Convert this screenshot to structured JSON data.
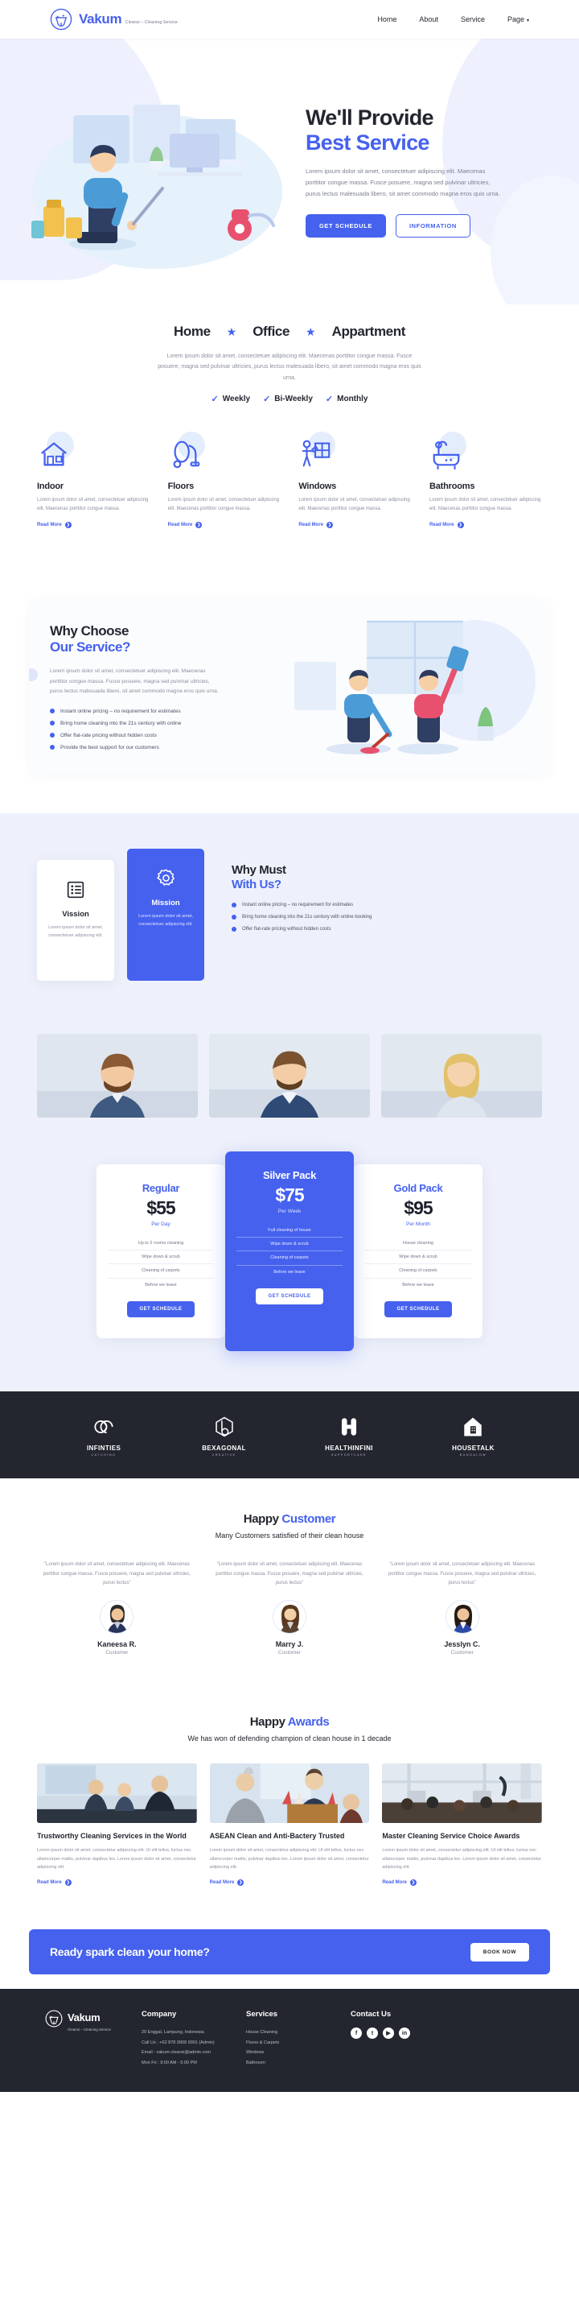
{
  "brand": {
    "name": "Vakum",
    "tagline": "Cleansi – Cleaning Service"
  },
  "nav": {
    "items": [
      "Home",
      "About",
      "Service",
      "Page"
    ],
    "caret": "▾"
  },
  "hero": {
    "title_line1": "We'll Provide",
    "title_line2": "Best Service",
    "desc": "Lorem ipsum dolor sit amet, consectetuer adipiscing elit. Maecenas porttitor congue massa. Fusce posuere, magna sed pulvinar ultricies, purus lectus malesuada libero, sit amet commodo magna eros quis urna.",
    "btn_primary": "GET SCHEDULE",
    "btn_outline": "INFORMATION"
  },
  "service_tabs": {
    "tabs": [
      "Home",
      "Office",
      "Appartment"
    ],
    "star": "★",
    "desc": "Lorem ipsum dolor sit amet, consectetuer adipiscing elit. Maecenas porttitor congue massa. Fusce posuere, magna sed pulvinar ultricies, purus lectus malesuada libero, sit amet commodo magna eros quis urna.",
    "frequencies": [
      "Weekly",
      "Bi-Weekly",
      "Monthly"
    ],
    "check": "✓"
  },
  "service_cards": {
    "read_more": "Read More",
    "arrow": "❯",
    "items": [
      {
        "icon": "house-icon",
        "title": "Indoor",
        "desc": "Lorem ipsum dolor sit amet, consectetuer adipiscing elit. Maecenas porttitor congue massa."
      },
      {
        "icon": "vacuum-icon",
        "title": "Floors",
        "desc": "Lorem ipsum dolor sit amet, consectetuer adipiscing elit. Maecenas porttitor congue massa."
      },
      {
        "icon": "window-cleaner-icon",
        "title": "Windows",
        "desc": "Lorem ipsum dolor sit amet, consectetuer adipiscing elit. Maecenas porttitor congue massa."
      },
      {
        "icon": "bathtub-icon",
        "title": "Bathrooms",
        "desc": "Lorem ipsum dolor sit amet, consectetuer adipiscing elit. Maecenas porttitor congue massa."
      }
    ]
  },
  "why_choose": {
    "title_line1": "Why Choose",
    "title_line2": "Our Service?",
    "desc": "Lorem ipsum dolor sit amet, consectetuer adipiscing elit. Maecenas porttitor congue massa. Fusce posuere, magna sed pulvinar ultricies, purus lectus malesuada libero, sit amet commodo magna eros quis urna.",
    "points": [
      "Instant online pricing – no requirement for estimates",
      "Bring home cleaning into the 21s century with online",
      "Offer flat-rate pricing without hidden costs",
      "Provide the best support for our customers"
    ]
  },
  "vision_mission": {
    "cards": [
      {
        "icon": "list-icon",
        "title": "Vission",
        "desc": "Lorem ipsum dolor sit amet, consectetuer adipiscing elit."
      },
      {
        "icon": "gear-icon",
        "title": "Mission",
        "desc": "Lorem ipsum dolor sit amet, consectetuer adipiscing elit."
      }
    ],
    "heading_line1": "Why Must",
    "heading_line2": "With Us?",
    "points": [
      "Instant online pricing – no requirement for estimates",
      "Bring home cleaning into the 21s century with online booking",
      "Offer flat-rate pricing without hidden costs"
    ]
  },
  "pricing": {
    "plans": [
      {
        "name": "Regular",
        "price": "$55",
        "per": "Per Day",
        "highlight": false,
        "features": [
          "Up to 2 rooms cleaning",
          "Wipe down & scrub",
          "Cleaning of carpets",
          "Before we leave"
        ],
        "button": "GET SCHEDULE"
      },
      {
        "name": "Silver Pack",
        "price": "$75",
        "per": "Per Week",
        "highlight": true,
        "features": [
          "Full cleaning of house",
          "Wipe down & scrub",
          "Cleaning of carpets",
          "Before we leave"
        ],
        "button": "GET SCHEDULE"
      },
      {
        "name": "Gold Pack",
        "price": "$95",
        "per": "Per Month",
        "highlight": false,
        "features": [
          "House cleaning",
          "Wipe down & scrub",
          "Cleaning of carpets",
          "Before we leave"
        ],
        "button": "GET SCHEDULE"
      }
    ]
  },
  "partners": [
    {
      "icon": "infinity-icon",
      "name": "INFINTIES",
      "sub": "CATCHING"
    },
    {
      "icon": "hexagon-b-icon",
      "name": "BEXAGONAL",
      "sub": "CREATIVE"
    },
    {
      "icon": "medical-cross-icon",
      "name": "HEALTHINFINI",
      "sub": "SUPPORTCARE"
    },
    {
      "icon": "house-p-icon",
      "name": "HOUSETALK",
      "sub": "BUNGALOW"
    }
  ],
  "testimonials": {
    "title_plain": "Happy ",
    "title_accent": "Customer",
    "subtitle": "Many Customers satisfied of their clean house",
    "items": [
      {
        "quote": "\"Lorem ipsum dolor sit amet, consectetuer adipiscing elit. Maecenas porttitor congue massa. Fusce posuere, magna sed pulvinar ultricies, purus lectus\"",
        "name": "Kaneesa R.",
        "role": "Customer"
      },
      {
        "quote": "\"Lorem ipsum dolor sit amet, consectetuer adipiscing elit. Maecenas porttitor congue massa. Fusce posuere, magna sed pulvinar ultricies, purus lectus\"",
        "name": "Marry J.",
        "role": "Customer"
      },
      {
        "quote": "\"Lorem ipsum dolor sit amet, consectetuer adipiscing elit. Maecenas porttitor congue massa. Fusce posuere, magna sed pulvinar ultricies, purus lectus\"",
        "name": "Jesslyn C.",
        "role": "Customer"
      }
    ]
  },
  "awards": {
    "title_plain": "Happy ",
    "title_accent": "Awards",
    "subtitle": "We has won of defending champion of clean house in 1 decade",
    "read_more": "Read More",
    "arrow": "❯",
    "items": [
      {
        "title": "Trustworthy Cleaning Services in the World",
        "desc": "Lorem ipsum dolor sit amet, consectetur adipiscing elit. Ut elit tellus, luctus nec ullamcorper mattis, pulvinar dapibus leo. Lorem ipsum dolor sit amet, consectetur adipiscing elit."
      },
      {
        "title": "ASEAN Clean and Anti-Bactery Trusted",
        "desc": "Lorem ipsum dolor sit amet, consectetur adipiscing elit. Ut elit tellus, luctus nec ullamcorper mattis, pulvinar dapibus leo. Lorem ipsum dolor sit amet, consectetur adipiscing elit."
      },
      {
        "title": "Master Cleaning Service Choice Awards",
        "desc": "Lorem ipsum dolor sit amet, consectetur adipiscing elit. Ut elit tellus, luctus nec ullamcorper mattis, pulvinar dapibus leo. Lorem ipsum dolor sit amet, consectetur adipiscing elit."
      }
    ]
  },
  "cta": {
    "title": "Ready spark clean your home?",
    "button": "BOOK NOW"
  },
  "footer": {
    "brand_name": "Vakum",
    "brand_tagline": "Cleansi – Cleaning Service",
    "company": {
      "heading": "Company",
      "lines": [
        "20 Enggal, Lampung, Indonesia",
        "Call Us : +62 878 9909 9901 (Admin)",
        "Email : vakum-cleansi@admin.com",
        "Mon Fri : 9:00 AM - 5:00 PM"
      ]
    },
    "services": {
      "heading": "Services",
      "lines": [
        "House Cleaning",
        "Floors & Carpets",
        "Windows",
        "Bathroom"
      ]
    },
    "contact": {
      "heading": "Contact Us",
      "socials": [
        "f",
        "t",
        "▶",
        "in"
      ]
    }
  },
  "colors": {
    "accent": "#4561ee",
    "dark": "#23262f",
    "light_bg": "#eef1fb"
  }
}
